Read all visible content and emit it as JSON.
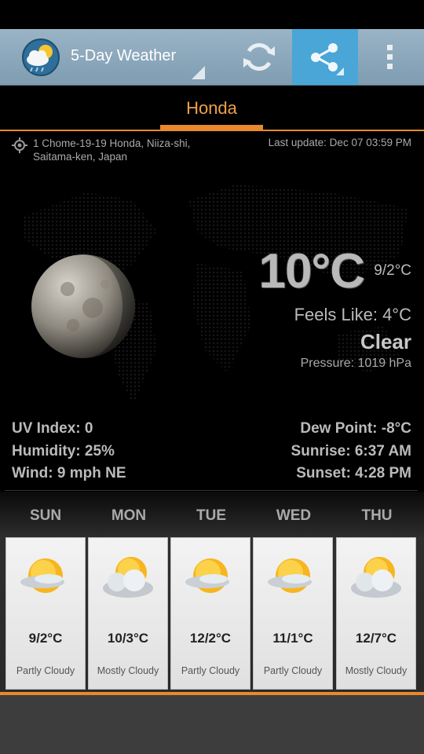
{
  "app": {
    "title": "5-Day Weather",
    "icons": {
      "app": "weather-app-icon",
      "refresh": "refresh-icon",
      "share": "share-icon",
      "overflow": "overflow-menu-icon"
    },
    "accent": "#e8892b",
    "share_bg": "#49a6d7"
  },
  "tab": {
    "label": "Honda"
  },
  "location": {
    "address_line1": "1 Chome-19-19 Honda, Niiza-shi,",
    "address_line2": "Saitama-ken, Japan",
    "last_update": "Last update: Dec 07  03:59 PM"
  },
  "current": {
    "temperature": "10°C",
    "hi_lo": "9/2°C",
    "feels_like": "Feels Like: 4°C",
    "condition": "Clear",
    "pressure": "Pressure: 1019 hPa",
    "uv_index": "UV Index: 0",
    "humidity": "Humidity: 25%",
    "wind": "Wind: 9 mph NE",
    "dew_point": "Dew Point: -8°C",
    "sunrise": "Sunrise: 6:37 AM",
    "sunset": "Sunset: 4:28 PM"
  },
  "forecast": [
    {
      "day": "SUN",
      "temp": "9/2°C",
      "condition": "Partly Cloudy"
    },
    {
      "day": "MON",
      "temp": "10/3°C",
      "condition": "Mostly Cloudy"
    },
    {
      "day": "TUE",
      "temp": "12/2°C",
      "condition": "Partly Cloudy"
    },
    {
      "day": "WED",
      "temp": "11/1°C",
      "condition": "Partly Cloudy"
    },
    {
      "day": "THU",
      "temp": "12/7°C",
      "condition": "Mostly Cloudy"
    }
  ]
}
